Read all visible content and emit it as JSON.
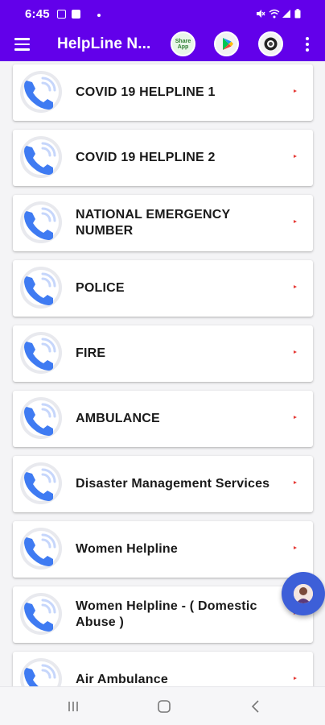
{
  "status_bar": {
    "time": "6:45"
  },
  "app_bar": {
    "title": "HelpLine N...",
    "share_app_label_line1": "Share",
    "share_app_label_line2": "App"
  },
  "colors": {
    "primary": "#6200ea",
    "fab": "#3d5fd8",
    "arrow": "#e53935",
    "phone_icon": "#3f7bf2"
  },
  "helplines": [
    {
      "label": "COVID 19 HELPLINE 1",
      "icon": "phone-call-icon"
    },
    {
      "label": "COVID 19 HELPLINE 2",
      "icon": "phone-call-icon"
    },
    {
      "label": "NATIONAL EMERGENCY NUMBER",
      "icon": "phone-call-icon"
    },
    {
      "label": "POLICE",
      "icon": "phone-call-icon"
    },
    {
      "label": "FIRE",
      "icon": "phone-call-icon"
    },
    {
      "label": "AMBULANCE",
      "icon": "phone-call-icon"
    },
    {
      "label": "Disaster Management Services",
      "icon": "phone-call-icon"
    },
    {
      "label": "Women Helpline",
      "icon": "phone-call-icon"
    },
    {
      "label": "Women Helpline - ( Domestic Abuse )",
      "icon": "phone-call-icon"
    },
    {
      "label": "Air Ambulance",
      "icon": "phone-call-icon"
    }
  ],
  "icons": {
    "menu": "hamburger-menu-icon",
    "share": "share-app-icon",
    "play": "play-store-icon",
    "camera": "camera-icon",
    "more": "more-vert-icon",
    "fab": "avatar-icon",
    "nav_recents": "recents-icon",
    "nav_home": "home-icon",
    "nav_back": "back-icon"
  }
}
